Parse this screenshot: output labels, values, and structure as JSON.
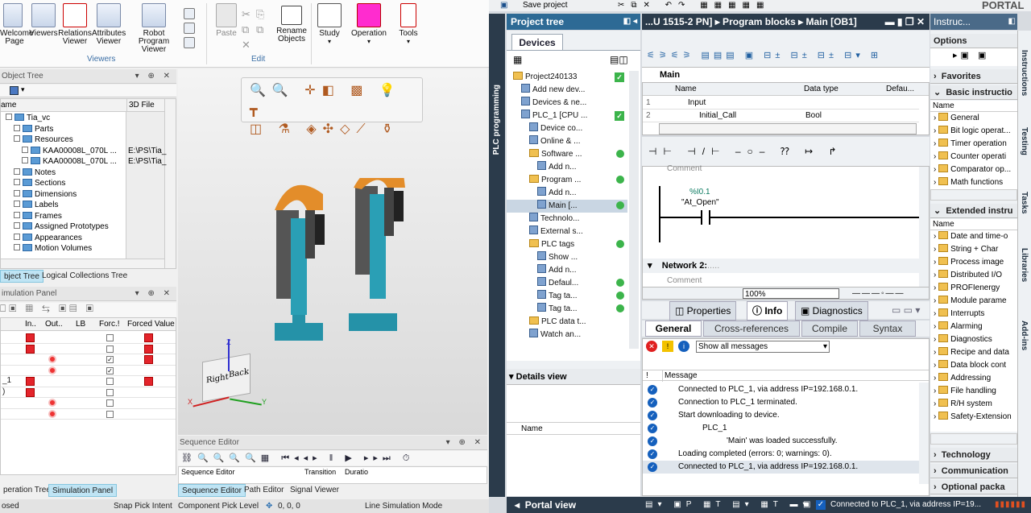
{
  "left_app": {
    "ribbon": {
      "viewers_buttons": [
        "Welcome Page",
        "Viewers",
        "Relations Viewer",
        "Attributes Viewer",
        "Robot Program Viewer"
      ],
      "viewers_group": "Viewers",
      "edit_buttons": {
        "paste": "Paste",
        "rename": "Rename Objects"
      },
      "edit_group": "Edit",
      "study": "Study",
      "operation": "Operation",
      "tools": "Tools"
    },
    "object_tree": {
      "title": "Object Tree",
      "col_name": "ame",
      "col_file": "3D File",
      "rows": [
        {
          "label": "Tia_vc",
          "file": "",
          "indent": 0
        },
        {
          "label": "Parts",
          "file": "",
          "indent": 1
        },
        {
          "label": "Resources",
          "file": "",
          "indent": 1
        },
        {
          "label": "KAA00008L_070L ...",
          "file": "E:\\PS\\Tia_",
          "indent": 2
        },
        {
          "label": "KAA00008L_070L ...",
          "file": "E:\\PS\\Tia_",
          "indent": 2
        },
        {
          "label": "Notes",
          "file": "",
          "indent": 1
        },
        {
          "label": "Sections",
          "file": "",
          "indent": 1
        },
        {
          "label": "Dimensions",
          "file": "",
          "indent": 1
        },
        {
          "label": "Labels",
          "file": "",
          "indent": 1
        },
        {
          "label": "Frames",
          "file": "",
          "indent": 1
        },
        {
          "label": "Assigned Prototypes",
          "file": "",
          "indent": 1
        },
        {
          "label": "Appearances",
          "file": "",
          "indent": 1
        },
        {
          "label": "Motion Volumes",
          "file": "",
          "indent": 1
        }
      ],
      "tabs": [
        "bject Tree",
        "Logical Collections Tree"
      ]
    },
    "simulation_panel": {
      "title": "imulation Panel",
      "columns": [
        "In..",
        "Out..",
        "LB",
        "Forc.!",
        "Forced Value"
      ],
      "row_labels": [
        "",
        "",
        "",
        "",
        "_1",
        ")",
        "",
        ""
      ],
      "tabs": [
        "peration Tree",
        "Simulation Panel"
      ]
    },
    "sequence_editor": {
      "title": "Sequence Editor",
      "col1": "Sequence Editor",
      "col2": "Transition",
      "col3": "Duratio",
      "tabs": [
        "Sequence Editor",
        "Path Editor",
        "Signal Viewer"
      ]
    },
    "viewcube": {
      "right": "Right",
      "back": "Back",
      "z": "Z",
      "x": "X",
      "y": "Y"
    },
    "status": {
      "left": "osed",
      "snap": "Snap Pick Intent",
      "component": "Component Pick Level",
      "coords": "0, 0, 0",
      "line": "Line Simulation Mode"
    }
  },
  "right_app": {
    "toolbar": {
      "save": "Save project",
      "brand": "PORTAL"
    },
    "project_tree": {
      "title": "Project tree",
      "tab": "Devices",
      "side_label": "PLC programming",
      "items": [
        {
          "label": "Project240133",
          "indent": 0,
          "status": "check"
        },
        {
          "label": "Add new dev...",
          "indent": 1,
          "status": ""
        },
        {
          "label": "Devices & ne...",
          "indent": 1,
          "status": ""
        },
        {
          "label": "PLC_1 [CPU ...",
          "indent": 1,
          "status": "check"
        },
        {
          "label": "Device co...",
          "indent": 2,
          "status": ""
        },
        {
          "label": "Online & ...",
          "indent": 2,
          "status": ""
        },
        {
          "label": "Software ...",
          "indent": 2,
          "status": "dot"
        },
        {
          "label": "Add n...",
          "indent": 3,
          "status": ""
        },
        {
          "label": "Program ...",
          "indent": 2,
          "status": "dot"
        },
        {
          "label": "Add n...",
          "indent": 3,
          "status": ""
        },
        {
          "label": "Main [...",
          "indent": 3,
          "status": "dot"
        },
        {
          "label": "Technolo...",
          "indent": 2,
          "status": ""
        },
        {
          "label": "External s...",
          "indent": 2,
          "status": ""
        },
        {
          "label": "PLC tags",
          "indent": 2,
          "status": "dot"
        },
        {
          "label": "Show ...",
          "indent": 3,
          "status": ""
        },
        {
          "label": "Add n...",
          "indent": 3,
          "status": ""
        },
        {
          "label": "Defaul...",
          "indent": 3,
          "status": "dot"
        },
        {
          "label": "Tag ta...",
          "indent": 3,
          "status": "dot"
        },
        {
          "label": "Tag ta...",
          "indent": 3,
          "status": "dot"
        },
        {
          "label": "PLC data t...",
          "indent": 2,
          "status": ""
        },
        {
          "label": "Watch an...",
          "indent": 2,
          "status": ""
        }
      ],
      "details": "Details view",
      "details_col": "Name",
      "portal_view": "Portal view"
    },
    "editor": {
      "title": "...U 1515-2 PN] ▸ Program blocks ▸ Main [OB1]",
      "block": "Main",
      "iface_cols": [
        "Name",
        "Data type",
        "Defau..."
      ],
      "iface_rows": [
        {
          "n": "1",
          "name": "Input",
          "type": ""
        },
        {
          "n": "2",
          "name": "Initial_Call",
          "type": "Bool"
        }
      ],
      "comment": "Comment",
      "contact_addr": "%I0.1",
      "contact_tag": "\"At_Open\"",
      "network2": "Network 2:",
      "network2_dots": ".....",
      "comment2": "Comment",
      "zoom": "100%"
    },
    "inspector": {
      "tabs": [
        "Properties",
        "Info",
        "Diagnostics"
      ],
      "subtabs": [
        "General",
        "Cross-references",
        "Compile",
        "Syntax"
      ],
      "filter": "Show all messages",
      "col_excl": "!",
      "col_msg": "Message",
      "messages": [
        {
          "text": "Connected to PLC_1, via address IP=192.168.0.1.",
          "indent": 0
        },
        {
          "text": "Connection to PLC_1 terminated.",
          "indent": 0
        },
        {
          "text": "Start downloading to device.",
          "indent": 0
        },
        {
          "text": "PLC_1",
          "indent": 1
        },
        {
          "text": "'Main' was loaded successfully.",
          "indent": 2
        },
        {
          "text": "Loading completed (errors: 0; warnings: 0).",
          "indent": 0
        },
        {
          "text": "Connected to PLC_1, via address IP=192.168.0.1.",
          "indent": 0
        }
      ]
    },
    "instructions": {
      "title": "Instruc...",
      "options": "Options",
      "favorites": "Favorites",
      "basic": "Basic instructio",
      "basic_col": "Name",
      "basic_items": [
        "General",
        "Bit logic operat...",
        "Timer operation",
        "Counter operati",
        "Comparator op...",
        "Math functions"
      ],
      "extended": "Extended instru",
      "ext_col": "Name",
      "ext_items": [
        "Date and time-o",
        "String + Char",
        "Process image",
        "Distributed I/O",
        "PROFIenergy",
        "Module parame",
        "Interrupts",
        "Alarming",
        "Diagnostics",
        "Recipe and data",
        "Data block cont",
        "Addressing",
        "File handling",
        "R/H system",
        "Safety-Extension"
      ],
      "technology": "Technology",
      "communication": "Communication",
      "optional": "Optional packa",
      "side_tabs": [
        "Instructions",
        "Testing",
        "Tasks",
        "Libraries",
        "Add-ins"
      ]
    },
    "statusbar": {
      "message": "Connected to PLC_1, via address IP=19..."
    }
  }
}
